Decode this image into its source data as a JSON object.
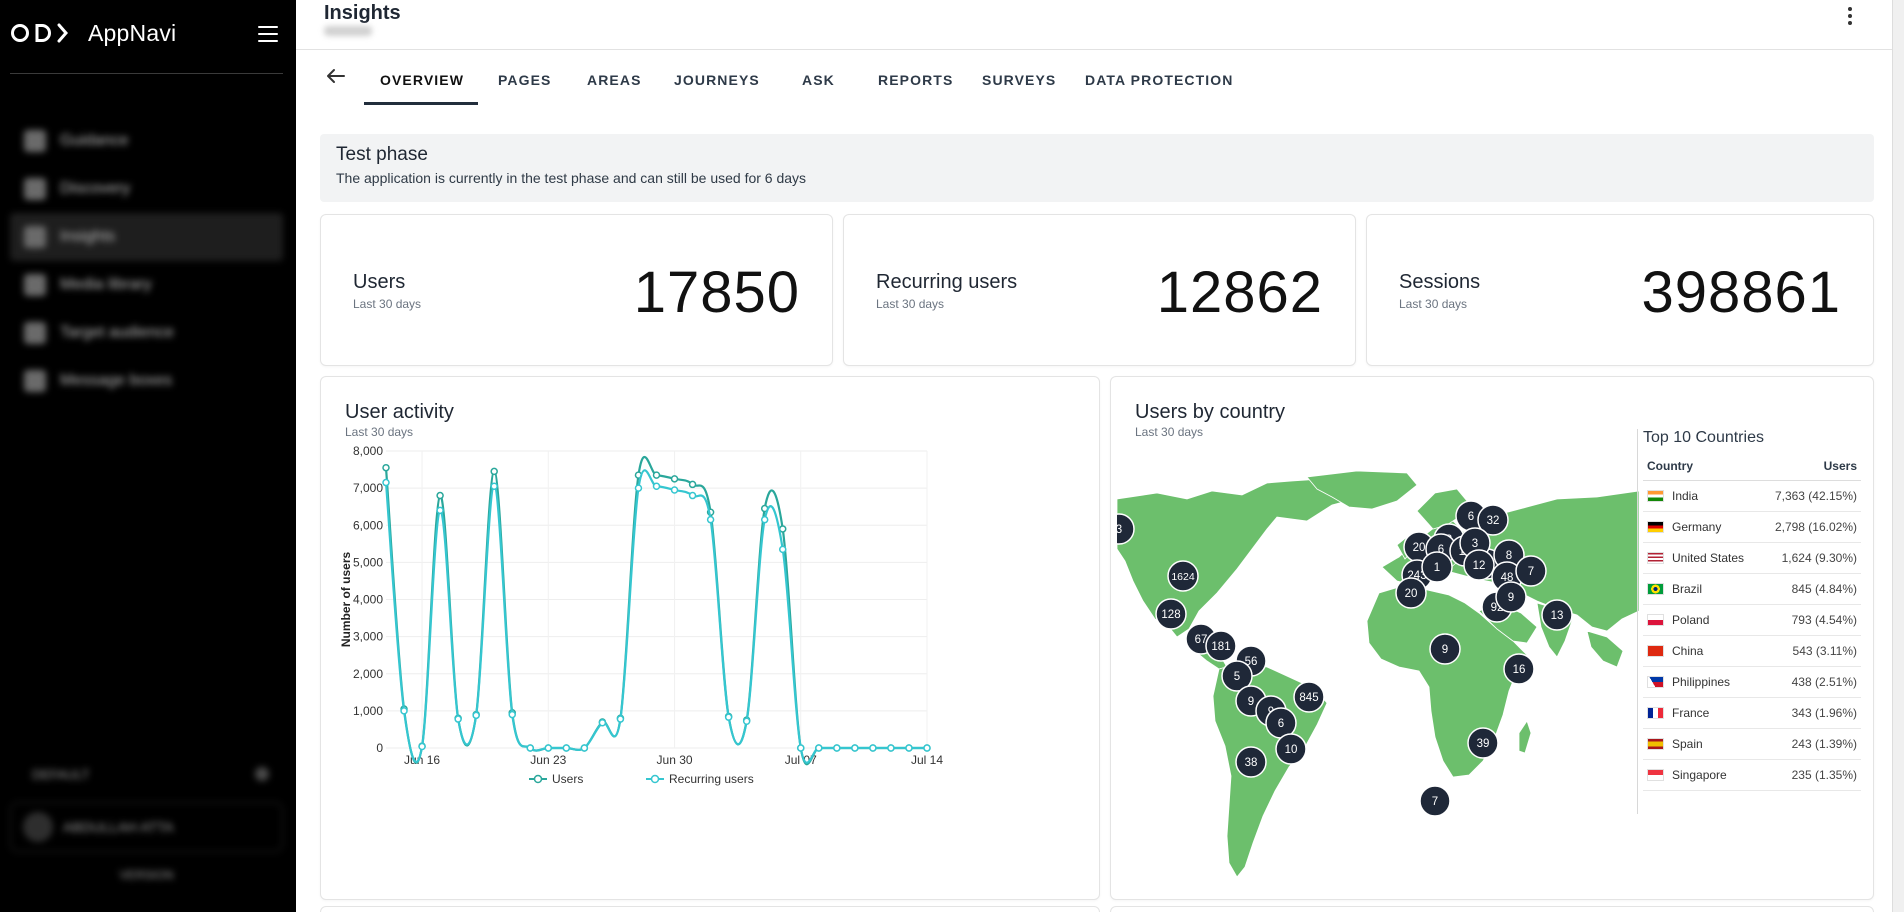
{
  "app": {
    "name": "AppNavi"
  },
  "sidebar": {
    "items": [
      {
        "label": "Guidance",
        "active": false
      },
      {
        "label": "Discovery",
        "active": false
      },
      {
        "label": "Insights",
        "active": true
      },
      {
        "label": "Media library",
        "active": false
      },
      {
        "label": "Target audience",
        "active": false
      },
      {
        "label": "Message boxes",
        "active": false
      }
    ],
    "section_label": "DEFAULT",
    "user_label": "ABDULLAH ATTA",
    "version_label": "VERSION"
  },
  "header": {
    "title": "Insights"
  },
  "tabs": [
    {
      "label": "OVERVIEW",
      "active": true
    },
    {
      "label": "PAGES"
    },
    {
      "label": "AREAS"
    },
    {
      "label": "JOURNEYS"
    },
    {
      "label": "ASK"
    },
    {
      "label": "REPORTS"
    },
    {
      "label": "SURVEYS"
    },
    {
      "label": "DATA PROTECTION"
    }
  ],
  "banner": {
    "title": "Test phase",
    "text": "The application is currently in the test phase and can still be used for 6 days"
  },
  "stats": [
    {
      "label": "Users",
      "sub": "Last 30 days",
      "value": "17850"
    },
    {
      "label": "Recurring users",
      "sub": "Last 30 days",
      "value": "12862"
    },
    {
      "label": "Sessions",
      "sub": "Last 30 days",
      "value": "398861"
    }
  ],
  "activity": {
    "title": "User activity",
    "sub": "Last 30 days"
  },
  "country": {
    "title": "Users by country",
    "sub": "Last 30 days",
    "table_title": "Top 10 Countries",
    "col_country": "Country",
    "col_users": "Users",
    "rows": [
      {
        "country": "India",
        "users": "7,363 (42.15%)",
        "flag": "india-flag"
      },
      {
        "country": "Germany",
        "users": "2,798 (16.02%)",
        "flag": "germany-flag"
      },
      {
        "country": "United States",
        "users": "1,624 (9.30%)",
        "flag": "usa-flag"
      },
      {
        "country": "Brazil",
        "users": "845 (4.84%)",
        "flag": "brazil-flag"
      },
      {
        "country": "Poland",
        "users": "793 (4.54%)",
        "flag": "poland-flag"
      },
      {
        "country": "China",
        "users": "543 (3.11%)",
        "flag": "china-flag"
      },
      {
        "country": "Philippines",
        "users": "438 (2.51%)",
        "flag": "philippines-flag"
      },
      {
        "country": "France",
        "users": "343 (1.96%)",
        "flag": "france-flag"
      },
      {
        "country": "Spain",
        "users": "243 (1.39%)",
        "flag": "spain-flag"
      },
      {
        "country": "Singapore",
        "users": "235 (1.35%)",
        "flag": "singapore-flag"
      }
    ],
    "clusters": [
      "1624",
      "128",
      "67",
      "181",
      "56",
      "5",
      "9",
      "9",
      "6",
      "845",
      "10",
      "38",
      "7",
      "6",
      "32",
      "8",
      "20",
      "6",
      "19",
      "71",
      "8",
      "48",
      "7",
      "243",
      "1",
      "20",
      "92",
      "9",
      "13",
      "9",
      "16",
      "39",
      "3",
      "3",
      "12"
    ],
    "colors": {
      "land": "#6cbf6c",
      "water": "#ffffff",
      "marker": "#1f2838"
    }
  },
  "chart_data": {
    "type": "line",
    "title": "",
    "xlabel": "",
    "ylabel": "Number of users",
    "ylim": [
      0,
      8000
    ],
    "yticks": [
      "0",
      "1,000",
      "2,000",
      "3,000",
      "4,000",
      "5,000",
      "6,000",
      "7,000",
      "8,000"
    ],
    "xtick_labels": [
      "Jun 16",
      "Jun 23",
      "Jun 30",
      "Jul 07",
      "Jul 14"
    ],
    "x": [
      "Jun 14",
      "Jun 15",
      "Jun 16",
      "Jun 17",
      "Jun 18",
      "Jun 19",
      "Jun 20",
      "Jun 21",
      "Jun 22",
      "Jun 23",
      "Jun 24",
      "Jun 25",
      "Jun 26",
      "Jun 27",
      "Jun 28",
      "Jun 29",
      "Jun 30",
      "Jul 01",
      "Jul 02",
      "Jul 03",
      "Jul 04",
      "Jul 05",
      "Jul 06",
      "Jul 07",
      "Jul 08",
      "Jul 09",
      "Jul 10",
      "Jul 11",
      "Jul 12",
      "Jul 13",
      "Jul 14"
    ],
    "series": [
      {
        "name": "Users",
        "color": "#2aa79b",
        "values": [
          7550,
          1050,
          50,
          6800,
          800,
          900,
          7450,
          950,
          0,
          0,
          0,
          0,
          700,
          800,
          7350,
          7350,
          7250,
          7100,
          6350,
          850,
          750,
          6450,
          5900,
          0,
          0,
          0,
          0,
          0,
          0,
          0,
          0
        ]
      },
      {
        "name": "Recurring users",
        "color": "#35c6d0",
        "values": [
          7150,
          1000,
          40,
          6400,
          780,
          880,
          7050,
          900,
          0,
          0,
          0,
          0,
          680,
          780,
          7000,
          7050,
          6950,
          6800,
          6150,
          830,
          720,
          6150,
          5350,
          0,
          0,
          0,
          0,
          0,
          0,
          0,
          0
        ]
      }
    ],
    "legend": "bottom-center",
    "grid": true
  }
}
